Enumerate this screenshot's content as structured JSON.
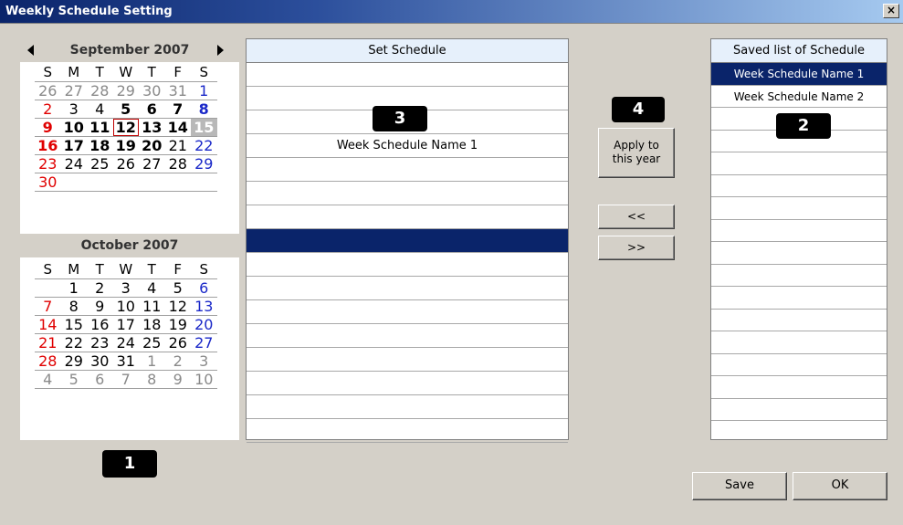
{
  "window": {
    "title": "Weekly Schedule Setting",
    "close_label": "×"
  },
  "calendar": {
    "september": {
      "title": "September 2007",
      "dow": [
        "S",
        "M",
        "T",
        "W",
        "T",
        "F",
        "S"
      ],
      "weeks": [
        [
          "26",
          "27",
          "28",
          "29",
          "30",
          "31",
          "1"
        ],
        [
          "2",
          "3",
          "4",
          "5",
          "6",
          "7",
          "8"
        ],
        [
          "9",
          "10",
          "11",
          "12",
          "13",
          "14",
          "15"
        ],
        [
          "16",
          "17",
          "18",
          "19",
          "20",
          "21",
          "22"
        ],
        [
          "23",
          "24",
          "25",
          "26",
          "27",
          "28",
          "29"
        ],
        [
          "30",
          "",
          "",
          "",
          "",
          "",
          ""
        ]
      ]
    },
    "october": {
      "title": "October 2007",
      "dow": [
        "S",
        "M",
        "T",
        "W",
        "T",
        "F",
        "S"
      ],
      "weeks": [
        [
          "",
          "1",
          "2",
          "3",
          "4",
          "5",
          "6"
        ],
        [
          "7",
          "8",
          "9",
          "10",
          "11",
          "12",
          "13"
        ],
        [
          "14",
          "15",
          "16",
          "17",
          "18",
          "19",
          "20"
        ],
        [
          "21",
          "22",
          "23",
          "24",
          "25",
          "26",
          "27"
        ],
        [
          "28",
          "29",
          "30",
          "31",
          "1",
          "2",
          "3"
        ],
        [
          "4",
          "5",
          "6",
          "7",
          "8",
          "9",
          "10"
        ]
      ]
    }
  },
  "set_schedule": {
    "header": "Set Schedule",
    "rows": [
      "",
      "",
      "",
      "Week Schedule Name 1",
      "",
      "",
      "",
      "",
      "",
      "",
      "",
      "",
      "",
      "",
      "",
      ""
    ]
  },
  "saved_list": {
    "header": "Saved list of Schedule",
    "items": [
      "Week Schedule Name 1",
      "Week Schedule Name 2"
    ]
  },
  "buttons": {
    "apply_line1": "Apply to",
    "apply_line2": "this year",
    "move_left": "<<",
    "move_right": ">>",
    "save": "Save",
    "ok": "OK"
  },
  "badges": {
    "b1": "1",
    "b2": "2",
    "b3": "3",
    "b4": "4"
  }
}
